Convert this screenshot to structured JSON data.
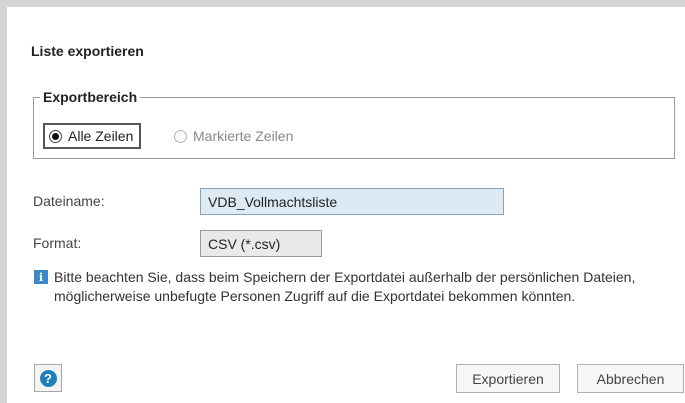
{
  "dialog": {
    "title": "Liste exportieren",
    "range": {
      "legend": "Exportbereich",
      "options": [
        {
          "label": "Alle Zeilen",
          "selected": true,
          "enabled": true
        },
        {
          "label": "Markierte Zeilen",
          "selected": false,
          "enabled": false
        }
      ]
    },
    "filename": {
      "label": "Dateiname:",
      "value": "VDB_Vollmachtsliste"
    },
    "format": {
      "label": "Format:",
      "value": "CSV (*.csv)"
    },
    "info": {
      "icon": "info-icon",
      "text": "Bitte beachten Sie, dass beim Speichern der Exportdatei außerhalb der persönlichen Dateien, möglicherweise unbefugte Personen Zugriff auf die Exportdatei bekommen könnten."
    },
    "buttons": {
      "help_icon": "question-icon",
      "export": "Exportieren",
      "cancel": "Abbrechen"
    },
    "colors": {
      "accent": "#3b87c7",
      "field_bg": "#dde9f3"
    }
  }
}
